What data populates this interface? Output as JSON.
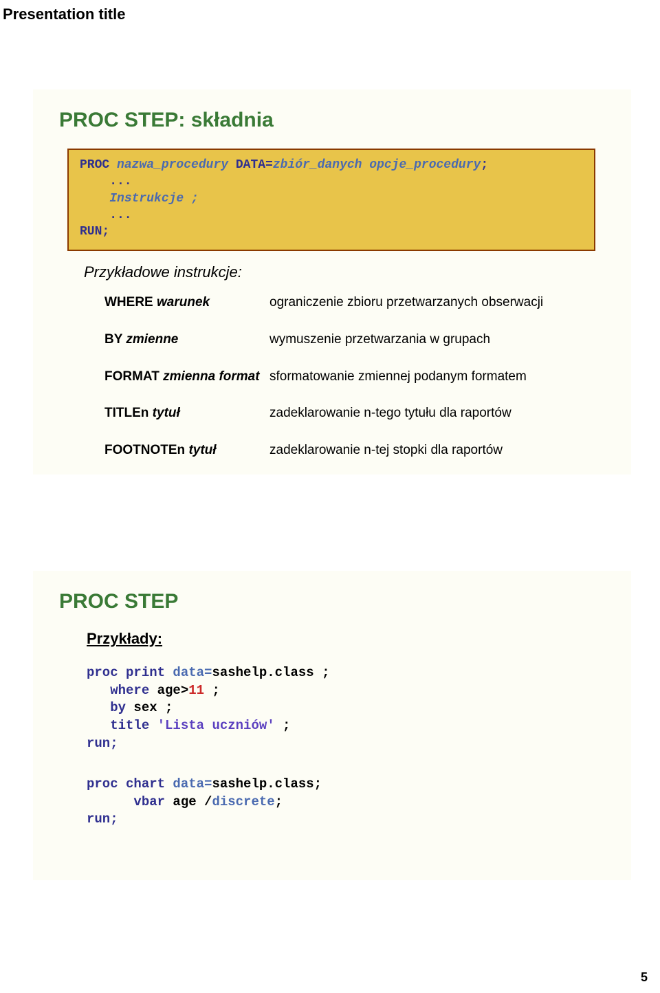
{
  "page": {
    "title": "Presentation title",
    "number": "5"
  },
  "slide1": {
    "heading": "PROC STEP: składnia",
    "code": {
      "l1a": "PROC ",
      "l1b": "nazwa_procedury ",
      "l1c": "DATA=",
      "l1d": "zbiór_danych opcje_procedury",
      "l1e": ";",
      "l2a": "    ...",
      "l3a": "    ",
      "l3b": "Instrukcje ;",
      "l4a": "    ...",
      "l5a": "RUN;"
    },
    "sub": "Przykładowe instrukcje:",
    "defs": [
      {
        "term": "WHERE",
        "termi": "warunek",
        "desc": "ograniczenie zbioru przetwarzanych obserwacji"
      },
      {
        "term": "BY",
        "termi": "zmienne",
        "desc": "wymuszenie przetwarzania w grupach"
      },
      {
        "term": "FORMAT",
        "termi": "zmienna format",
        "desc": "sformatowanie zmiennej podanym formatem"
      },
      {
        "term": "TITLEn",
        "termi": "tytuł",
        "desc": "zadeklarowanie n-tego tytułu dla raportów"
      },
      {
        "term": "FOOTNOTEn",
        "termi": "tytuł",
        "desc": "zadeklarowanie n-tej stopki dla raportów"
      }
    ]
  },
  "slide2": {
    "heading": "PROC STEP",
    "examplesHead": "Przykłady:",
    "ex1": {
      "l1a": "proc print ",
      "l1b": "data=",
      "l1c": "sashelp.class ;",
      "l2a": "   where ",
      "l2b": "age>",
      "l2c": "11",
      "l2d": " ;",
      "l3a": "   by ",
      "l3b": "sex ;",
      "l4a": "   title ",
      "l4b": "'Lista uczniów'",
      "l4c": " ;",
      "l5a": "run;"
    },
    "ex2": {
      "l1a": "proc chart ",
      "l1b": "data=",
      "l1c": "sashelp.class;",
      "l2a": "      vbar ",
      "l2b": "age /",
      "l2c": "discrete",
      "l2d": ";",
      "l3a": "run;"
    }
  }
}
